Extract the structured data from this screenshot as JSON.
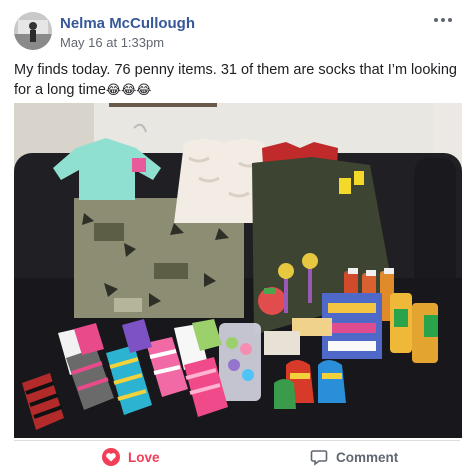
{
  "post": {
    "author": "Nelma McCullough",
    "timestamp": "May 16 at 1:33pm",
    "caption_text": "My finds today. 76 penny items. 31 of them are socks that I’m looking for a long time",
    "caption_emojis": "😂😂😂"
  },
  "actions": {
    "love_label": "Love",
    "comment_label": "Comment"
  },
  "icons": {
    "more": "more-options-icon",
    "love": "heart-icon",
    "comment": "comment-bubble-icon"
  },
  "colors": {
    "author": "#365899",
    "love": "#f33e58",
    "muted": "#606770"
  }
}
